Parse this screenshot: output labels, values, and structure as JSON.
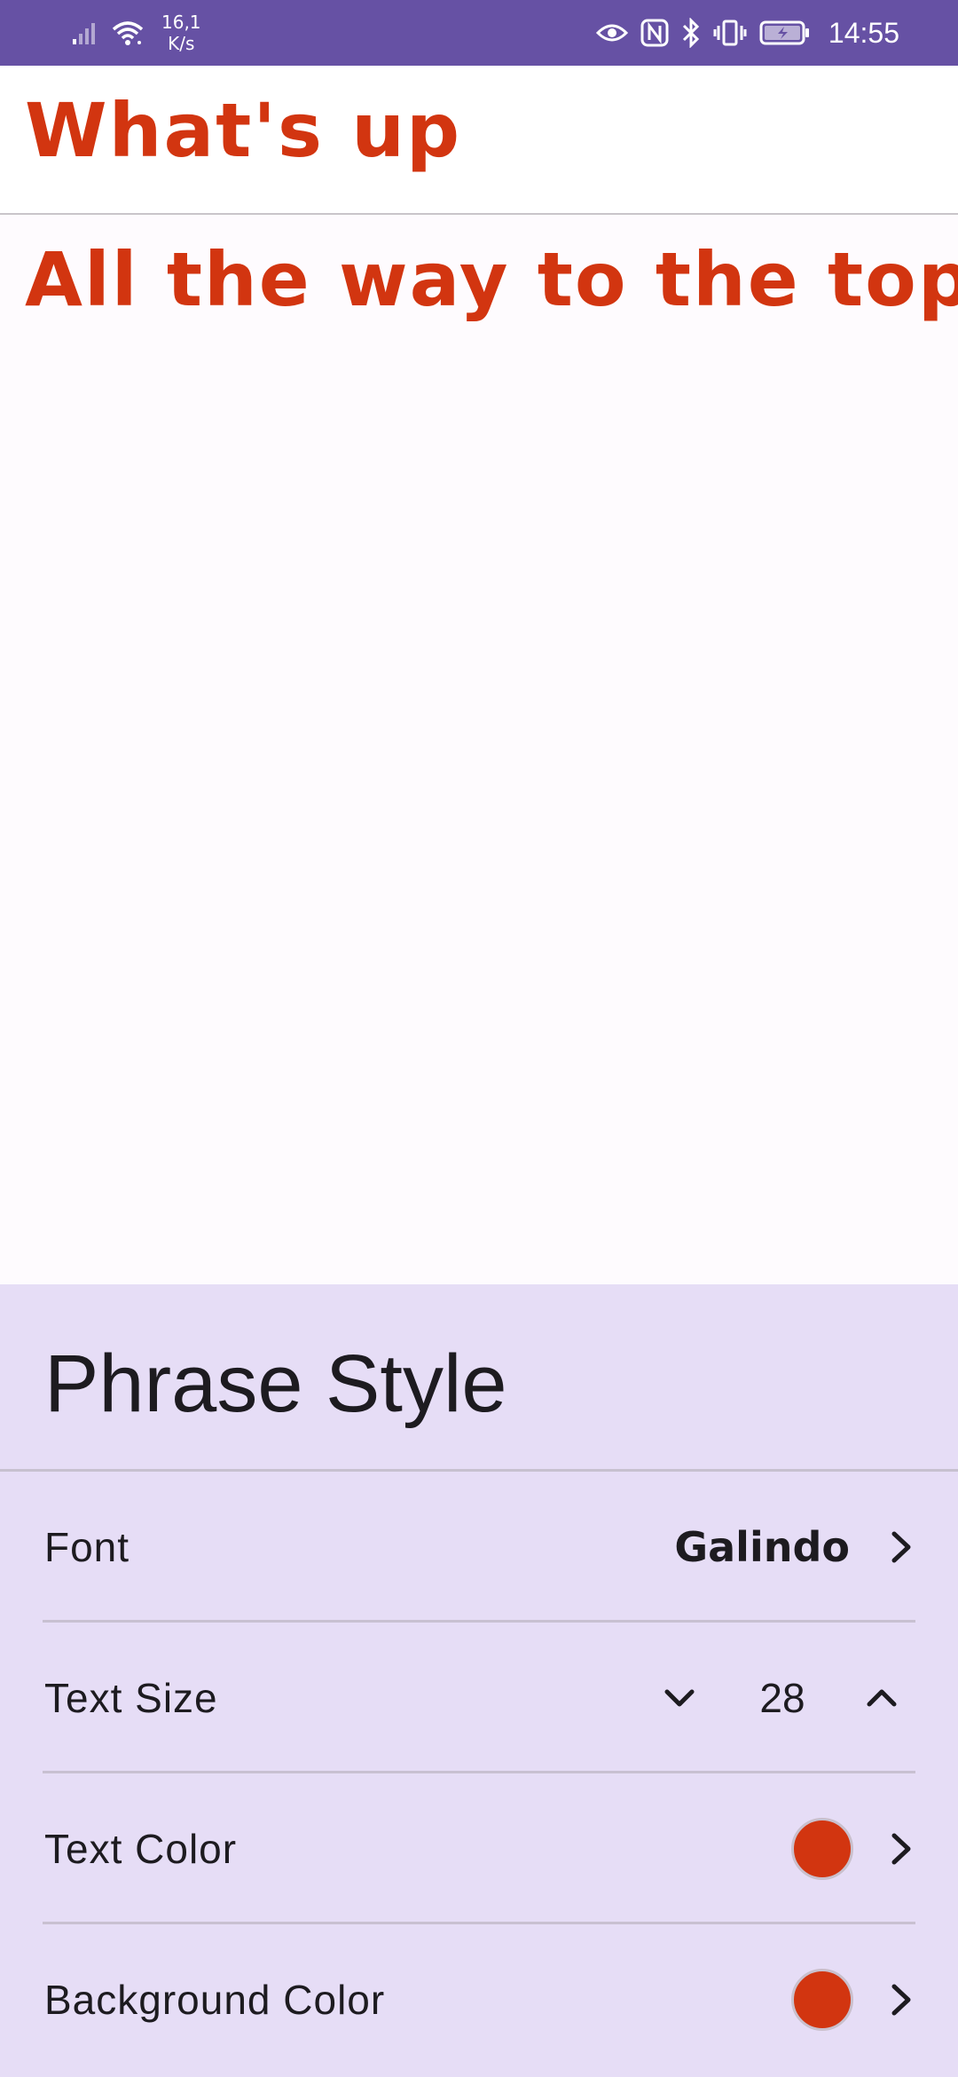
{
  "status_bar": {
    "net_speed_value": "16,1",
    "net_speed_unit": "K/s",
    "time": "14:55",
    "icons": [
      "signal-icon",
      "wifi-icon",
      "eye-icon",
      "nfc-icon",
      "bluetooth-icon",
      "vibrate-icon",
      "battery-charging-icon"
    ]
  },
  "phrases": [
    {
      "text": "What's up"
    },
    {
      "text": "All the way to the top"
    }
  ],
  "sheet": {
    "title": "Phrase Style",
    "font": {
      "label": "Font",
      "value": "Galindo"
    },
    "text_size": {
      "label": "Text Size",
      "value": "28"
    },
    "text_color": {
      "label": "Text Color",
      "color": "#d23510"
    },
    "background_color": {
      "label": "Background Color",
      "color": "#d23510"
    }
  },
  "colors": {
    "status_bar": "#6651a4",
    "accent": "#d23510",
    "sheet_background": "#e6ddf6"
  }
}
